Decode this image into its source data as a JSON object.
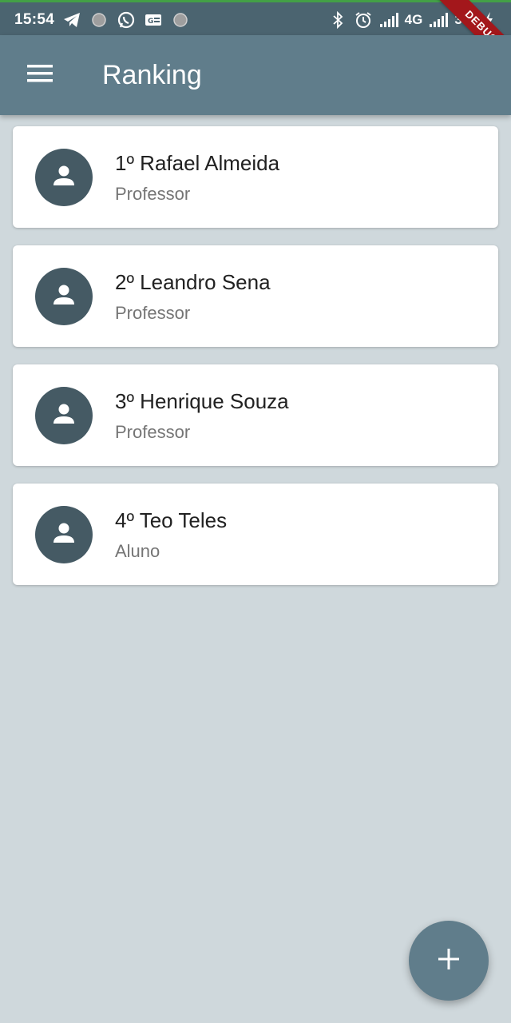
{
  "status_bar": {
    "time": "15:54",
    "network_1": "4G",
    "network_2": "3G",
    "left_icons": [
      "telegram-icon",
      "notification-dot-icon",
      "whatsapp-icon",
      "id-card-icon",
      "notification-dot-icon"
    ],
    "right_icons": [
      "bluetooth-icon",
      "alarm-icon",
      "signal-icon",
      "signal-icon",
      "charging-icon"
    ]
  },
  "debug_banner": "DEBUG",
  "app_bar": {
    "title": "Ranking",
    "menu_icon": "menu-icon",
    "color": "#607d8b"
  },
  "ranking": [
    {
      "title": "1º Rafael Almeida",
      "subtitle": "Professor"
    },
    {
      "title": "2º Leandro Sena",
      "subtitle": "Professor"
    },
    {
      "title": "3º Henrique Souza",
      "subtitle": "Professor"
    },
    {
      "title": "4º Teo Teles",
      "subtitle": "Aluno"
    }
  ],
  "avatar_icon": "person-icon",
  "avatar_color": "#455a64",
  "fab": {
    "icon": "add-icon",
    "color": "#607d8b"
  },
  "background_color": "#cfd8dc"
}
